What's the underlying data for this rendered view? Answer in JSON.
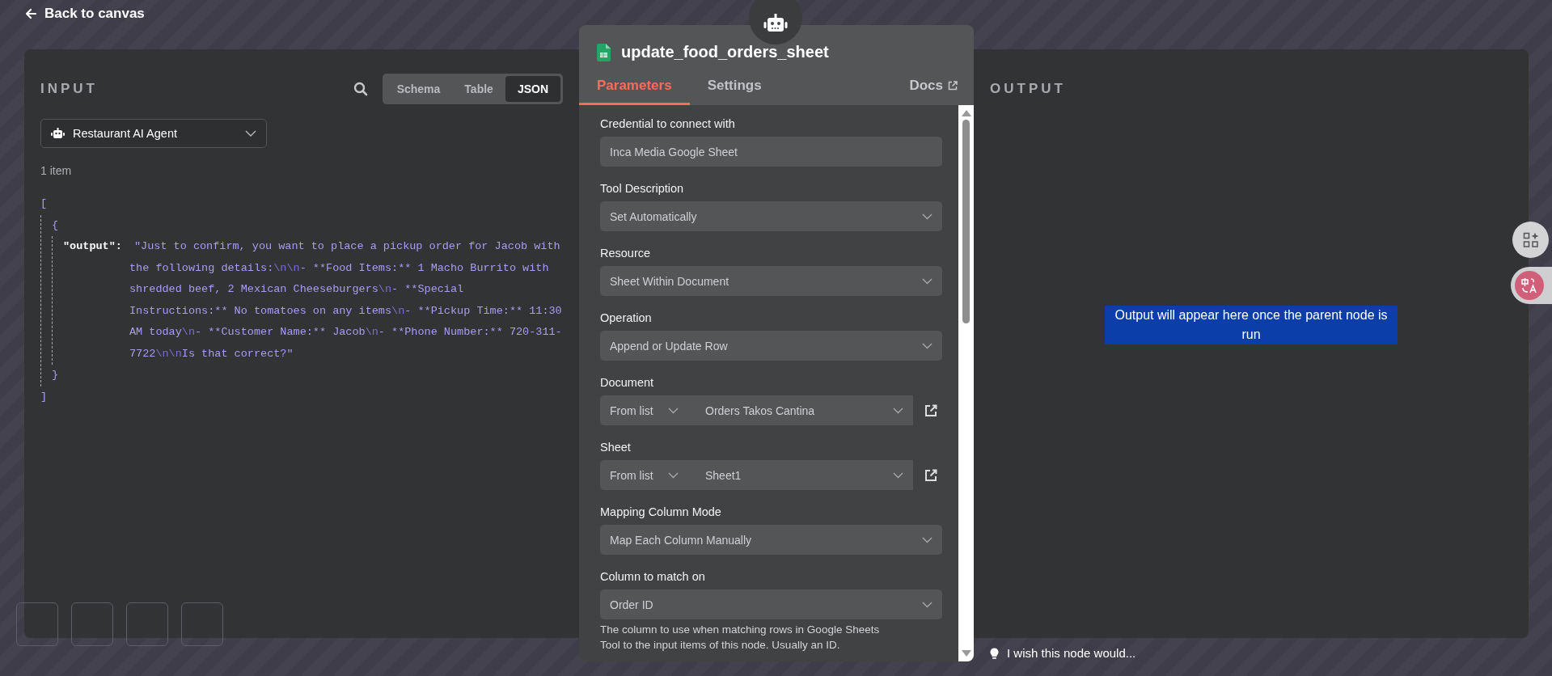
{
  "back_link": "Back to canvas",
  "input": {
    "title": "INPUT",
    "view_tabs": [
      {
        "label": "Schema",
        "selected": false
      },
      {
        "label": "Table",
        "selected": false
      },
      {
        "label": "JSON",
        "selected": true
      }
    ],
    "source_node": "Restaurant AI Agent",
    "item_count": "1 item",
    "json": {
      "open_array": "[",
      "open_object": "{",
      "key": "\"output\":",
      "close_object": "}",
      "close_array": "]",
      "value_lines": [
        "\"Just to confirm, you want to place a pickup order for Jacob with",
        "the following details:\\n\\n- **Food Items:** 1 Macho Burrito with",
        "shredded beef, 2 Mexican Cheeseburgers\\n- **Special",
        "Instructions:** No tomatoes on any items\\n- **Pickup Time:** 11:30",
        "AM today\\n- **Customer Name:** Jacob\\n- **Phone Number:** 720-311-",
        "7722\\n\\nIs that correct?\""
      ]
    }
  },
  "node": {
    "title": "update_food_orders_sheet",
    "tabs": [
      {
        "label": "Parameters",
        "selected": true
      },
      {
        "label": "Settings",
        "selected": false
      }
    ],
    "docs_link": "Docs",
    "fields": [
      {
        "kind": "text",
        "label": "Credential to connect with",
        "value": "Inca Media Google Sheet"
      },
      {
        "kind": "select",
        "label": "Tool Description",
        "value": "Set Automatically"
      },
      {
        "kind": "select",
        "label": "Resource",
        "value": "Sheet Within Document"
      },
      {
        "kind": "select",
        "label": "Operation",
        "value": "Append or Update Row"
      },
      {
        "kind": "locator",
        "label": "Document",
        "mode": "From list",
        "value": "Orders Takos Cantina"
      },
      {
        "kind": "locator",
        "label": "Sheet",
        "mode": "From list",
        "value": "Sheet1"
      },
      {
        "kind": "select",
        "label": "Mapping Column Mode",
        "value": "Map Each Column Manually"
      },
      {
        "kind": "select",
        "label": "Column to match on",
        "value": "Order ID",
        "hint": "The column to use when matching rows in Google Sheets Tool to the input items of this node. Usually an ID."
      }
    ]
  },
  "output": {
    "title": "OUTPUT",
    "message": "Output will appear here once the parent node is run",
    "message_selected": true
  },
  "feedback": "I wish this node would..."
}
